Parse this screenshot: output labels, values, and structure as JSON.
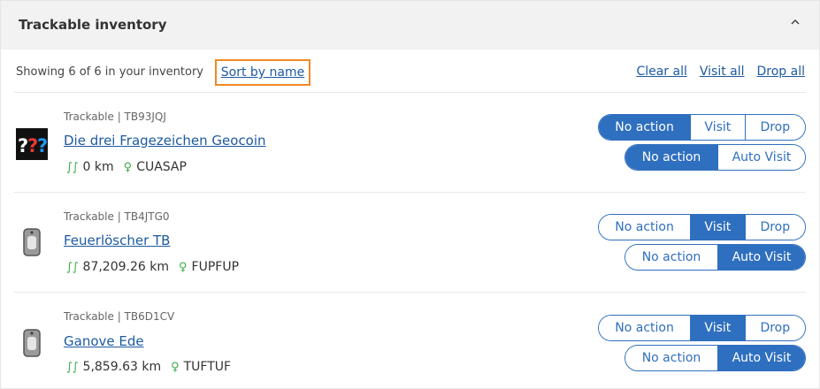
{
  "panel": {
    "title": "Trackable inventory"
  },
  "toolbar": {
    "summary": "Showing 6 of 6 in your inventory",
    "sort_label": "Sort by name",
    "clear_all": "Clear all",
    "visit_all": "Visit all",
    "drop_all": "Drop all"
  },
  "action_labels": {
    "no_action": "No action",
    "visit": "Visit",
    "drop": "Drop",
    "auto_visit": "Auto Visit"
  },
  "trackables": [
    {
      "meta": "Trackable | TB93JQJ",
      "name": "Die drei Fragezeichen Geocoin",
      "distance": "0 km",
      "owner": "CUASAP",
      "selected_action": "No action",
      "auto_selected": "No action",
      "icon": "question-marks-logo"
    },
    {
      "meta": "Trackable | TB4JTG0",
      "name": "Feuerlöscher TB",
      "distance": "87,209.26 km",
      "owner": "FUPFUP",
      "selected_action": "Visit",
      "auto_selected": "Auto Visit",
      "icon": "travel-bug-tag"
    },
    {
      "meta": "Trackable | TB6D1CV",
      "name": "Ganove Ede",
      "distance": "5,859.63 km",
      "owner": "TUFTUF",
      "selected_action": "Visit",
      "auto_selected": "Auto Visit",
      "icon": "travel-bug-tag"
    }
  ],
  "colors": {
    "accent": "#2f6fbf",
    "link": "#1e5aa0",
    "highlight": "#f08a24",
    "green": "#3daa4a"
  }
}
